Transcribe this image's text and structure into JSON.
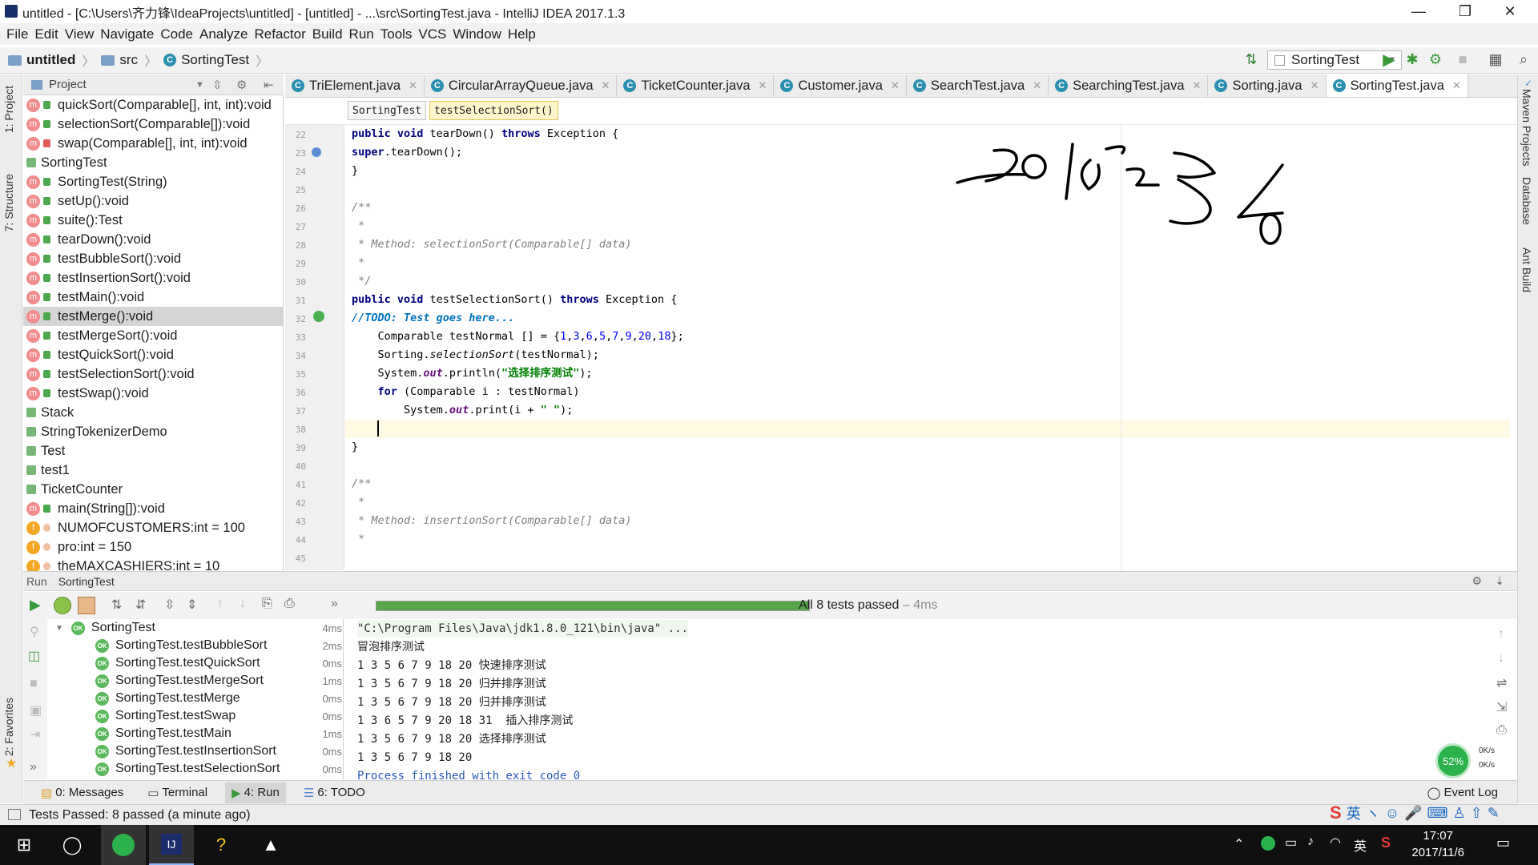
{
  "window": {
    "title": "untitled - [C:\\Users\\齐力锋\\IdeaProjects\\untitled] - [untitled] - ...\\src\\SortingTest.java - IntelliJ IDEA 2017.1.3"
  },
  "menu": [
    "File",
    "Edit",
    "View",
    "Navigate",
    "Code",
    "Analyze",
    "Refactor",
    "Build",
    "Run",
    "Tools",
    "VCS",
    "Window",
    "Help"
  ],
  "nav": {
    "project": "untitled",
    "folder": "src",
    "file": "SortingTest",
    "run_config": "SortingTest"
  },
  "left_tabs": {
    "project": "1: Project",
    "structure": "7: Structure",
    "favorites": "2: Favorites"
  },
  "right_tabs": {
    "maven": "Maven Projects",
    "database": "Database",
    "ant": "Ant Build"
  },
  "project_panel": {
    "header": "Project"
  },
  "tree": [
    {
      "kind": "m",
      "text": "quickSort(Comparable[], int, int):void"
    },
    {
      "kind": "m",
      "text": "selectionSort(Comparable[]):void"
    },
    {
      "kind": "m",
      "text": "swap(Comparable[], int, int):void"
    },
    {
      "kind": "c",
      "text": "SortingTest"
    },
    {
      "kind": "m",
      "text": "SortingTest(String)"
    },
    {
      "kind": "m",
      "text": "setUp():void"
    },
    {
      "kind": "m",
      "text": "suite():Test"
    },
    {
      "kind": "m",
      "text": "tearDown():void"
    },
    {
      "kind": "m",
      "text": "testBubbleSort():void"
    },
    {
      "kind": "m",
      "text": "testInsertionSort():void"
    },
    {
      "kind": "m",
      "text": "testMain():void"
    },
    {
      "kind": "m",
      "text": "testMerge():void"
    },
    {
      "kind": "m",
      "text": "testMergeSort():void"
    },
    {
      "kind": "m",
      "text": "testQuickSort():void"
    },
    {
      "kind": "m",
      "text": "testSelectionSort():void"
    },
    {
      "kind": "m",
      "text": "testSwap():void"
    },
    {
      "kind": "c",
      "text": "Stack"
    },
    {
      "kind": "c",
      "text": "StringTokenizerDemo"
    },
    {
      "kind": "c",
      "text": "Test"
    },
    {
      "kind": "c",
      "text": "test1"
    },
    {
      "kind": "c",
      "text": "TicketCounter"
    },
    {
      "kind": "m",
      "text": "main(String[]):void"
    },
    {
      "kind": "f",
      "text": "NUMOFCUSTOMERS:int = 100"
    },
    {
      "kind": "f",
      "text": "pro:int = 150"
    },
    {
      "kind": "f",
      "text": "theMAXCASHIERS:int = 10"
    }
  ],
  "tabs": [
    "TriElement.java",
    "CircularArrayQueue.java",
    "TicketCounter.java",
    "Customer.java",
    "SearchTest.java",
    "SearchingTest.java",
    "Sorting.java",
    "SortingTest.java"
  ],
  "editor_crumbs": [
    "SortingTest",
    "testSelectionSort()"
  ],
  "line_numbers": [
    "22",
    "23",
    "24",
    "25",
    "26",
    "27",
    "28",
    "29",
    "30",
    "31",
    "32",
    "33",
    "34",
    "35",
    "36",
    "37",
    "38",
    "39",
    "40",
    "41",
    "42",
    "43",
    "44",
    "45"
  ],
  "code": {
    "l23a": "public void ",
    "l23b": "tearDown",
    "l23c": "() ",
    "l23d": "throws",
    "l23e": " Exception {",
    "l24a": "super",
    ".l24b": "",
    "l24c": ".tearDown();",
    "l25": "}",
    "l27": "/**",
    "l28": " *",
    "l29": " * Method: selectionSort(Comparable[] data)",
    "l30": " *",
    "l31": " */",
    "l32a": "public void ",
    "l32b": "testSelectionSort() ",
    "l32c": "throws",
    "l32d": " Exception {",
    "l33a": "//TODO: Test goes here...",
    "l34a": "    Comparable testNormal [] = {",
    "l34b": "1",
    "l34c": ",",
    "l34d": "3",
    "l34e": ",",
    "l34f": "6",
    "l34g": ",",
    "l34h": "5",
    "l34i": ",",
    "l34j": "7",
    "l34k": ",",
    "l34l": "9",
    "l34m": ",",
    "l34n": "20",
    "l34o": ",",
    "l34p": "18",
    "l34q": "};",
    "l35a": "    Sorting.",
    "l35b": "selectionSort",
    "l35c": "(testNormal);",
    "l36a": "    System.",
    "l36b": "out",
    "l36c": ".println(",
    "l36d": "\"选择排序测试\"",
    "l36e": ");",
    "l37a": "    ",
    "l37b": "for",
    "l37c": " (Comparable i : testNormal)",
    "l38a": "        System.",
    "l38b": "out",
    "l38c": ".print(i + ",
    "l38d": "\" \"",
    "l38e": ");",
    "l40": "}",
    "l42": "/**",
    "l43": " *",
    "l44": " * Method: insertionSort(Comparable[] data)",
    "l45": " *"
  },
  "run": {
    "header_a": "Run",
    "header_b": "SortingTest",
    "status_a": "All 8 tests passed",
    "status_b": " – 4ms",
    "progress": 1.0,
    "tests": [
      {
        "name": "SortingTest",
        "time": "4ms"
      },
      {
        "name": "SortingTest.testBubbleSort",
        "time": "2ms"
      },
      {
        "name": "SortingTest.testQuickSort",
        "time": "0ms"
      },
      {
        "name": "SortingTest.testMergeSort",
        "time": "1ms"
      },
      {
        "name": "SortingTest.testMerge",
        "time": "0ms"
      },
      {
        "name": "SortingTest.testSwap",
        "time": "0ms"
      },
      {
        "name": "SortingTest.testMain",
        "time": "1ms"
      },
      {
        "name": "SortingTest.testInsertionSort",
        "time": "0ms"
      },
      {
        "name": "SortingTest.testSelectionSort",
        "time": "0ms"
      }
    ],
    "console": [
      "\"C:\\Program Files\\Java\\jdk1.8.0_121\\bin\\java\" ...",
      "冒泡排序测试",
      "1 3 5 6 7 9 18 20 快速排序测试",
      "1 3 5 6 7 9 18 20 归并排序测试",
      "1 3 5 6 7 9 18 20 归并排序测试",
      "1 3 6 5 7 9 20 18 31  插入排序测试",
      "1 3 5 6 7 9 18 20 选择排序测试",
      "1 3 5 6 7 9 18 20",
      "Process finished with exit code 0"
    ]
  },
  "bottom_tabs": [
    "0: Messages",
    "Terminal",
    "4: Run",
    "6: TODO"
  ],
  "event_log": "Event Log",
  "statusbar": "Tests Passed: 8 passed (a minute ago)",
  "net": {
    "percent": "52%",
    "up": "0K/s",
    "down": "0K/s"
  },
  "ime": {
    "lang": "英"
  },
  "taskbar": {
    "time": "17:07",
    "date": "2017/11/6",
    "lang": "英"
  },
  "colors": {
    "accent": "#2a8eaf",
    "pass": "#57a64a",
    "keyword": "#000080",
    "string": "#008000"
  }
}
